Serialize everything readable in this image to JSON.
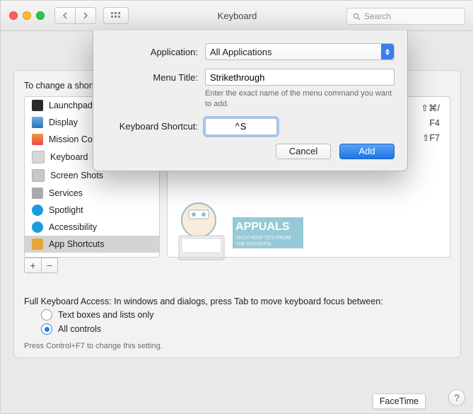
{
  "window": {
    "title": "Keyboard",
    "search_placeholder": "Search"
  },
  "prefs": {
    "intro": "To change a shortcut, select it, double-click the key combination, then type the new keys.",
    "right_shortcuts": [
      "⇧⌘/",
      "F4",
      "⇧F7"
    ],
    "fka_label": "Full Keyboard Access: In windows and dialogs, press Tab to move keyboard focus between:",
    "fka_opt1": "Text boxes and lists only",
    "fka_opt2": "All controls",
    "fka_hint": "Press Control+F7 to change this setting."
  },
  "sidebar": {
    "items": [
      {
        "label": "Launchpad & Dock",
        "icon": "launchpad"
      },
      {
        "label": "Display",
        "icon": "display"
      },
      {
        "label": "Mission Control",
        "icon": "mission"
      },
      {
        "label": "Keyboard",
        "icon": "keyboard"
      },
      {
        "label": "Screen Shots",
        "icon": "screensh"
      },
      {
        "label": "Services",
        "icon": "services"
      },
      {
        "label": "Spotlight",
        "icon": "spotlight"
      },
      {
        "label": "Accessibility",
        "icon": "accessibility"
      },
      {
        "label": "App Shortcuts",
        "icon": "appsh"
      }
    ],
    "selected_index": 8,
    "add_label": "+",
    "remove_label": "−"
  },
  "sheet": {
    "app_label": "Application:",
    "app_value": "All Applications",
    "menu_label": "Menu Title:",
    "menu_value": "Strikethrough",
    "menu_hint": "Enter the exact name of the menu command you want to add.",
    "shortcut_label": "Keyboard Shortcut:",
    "shortcut_value": "^S",
    "cancel": "Cancel",
    "add": "Add"
  },
  "footer": {
    "facetime": "FaceTime",
    "help": "?"
  },
  "watermark": {
    "title": "APPUALS",
    "sub1": "TECH HOW-TO'S FROM",
    "sub2": "THE EXPERTS!"
  }
}
